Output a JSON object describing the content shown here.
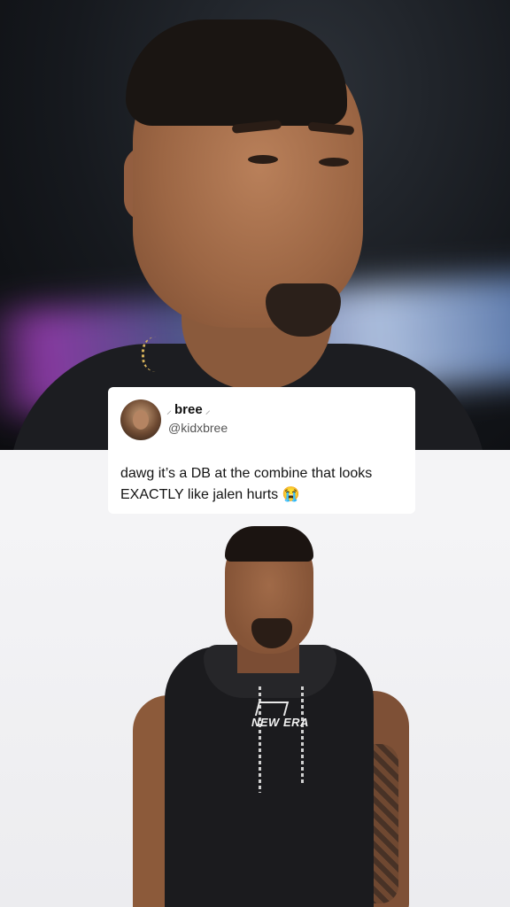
{
  "tweet": {
    "display_name": "bree",
    "name_decoration_icon": "leaf-icon",
    "handle": "@kidxbree",
    "text": "dawg it’s a DB at the combine that looks EXACTLY like jalen hurts 😭"
  },
  "bottom_photo": {
    "shirt_brand": "NEW ERA"
  },
  "colors": {
    "card_background": "#ffffff",
    "panel_background": "#f4f4f6",
    "text_primary": "#141414",
    "text_secondary": "#555555"
  }
}
